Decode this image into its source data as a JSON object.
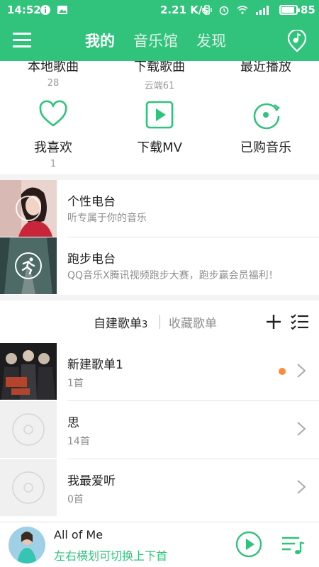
{
  "status_bar": {
    "time": "14:52",
    "network_speed": "2.21 K/s",
    "battery": "85"
  },
  "app_bar": {
    "tabs": [
      {
        "label": "我的",
        "active": true
      },
      {
        "label": "音乐馆",
        "active": false
      },
      {
        "label": "发现",
        "active": false
      }
    ]
  },
  "quick_access": {
    "row1": [
      {
        "label": "本地歌曲",
        "sub": "28"
      },
      {
        "label": "下载歌曲",
        "sub": "云端61"
      },
      {
        "label": "最近播放",
        "sub": ""
      }
    ],
    "row2": [
      {
        "label": "我喜欢",
        "sub": "1",
        "icon": "heart-icon"
      },
      {
        "label": "下载MV",
        "sub": "",
        "icon": "video-play-icon"
      },
      {
        "label": "已购音乐",
        "sub": "",
        "icon": "purchased-disc-icon"
      }
    ]
  },
  "radios": [
    {
      "title": "个性电台",
      "desc": "听专属于你的音乐"
    },
    {
      "title": "跑步电台",
      "desc": "QQ音乐X腾讯视频跑步大赛，跑步赢会员福利！"
    }
  ],
  "playlists": {
    "tab_created": "自建歌单",
    "tab_created_count": "3",
    "tab_collected": "收藏歌单",
    "items": [
      {
        "name": "新建歌单1",
        "count": "1首",
        "has_dot": true
      },
      {
        "name": "思",
        "count": "14首",
        "has_dot": false
      },
      {
        "name": "我最爱听",
        "count": "0首",
        "has_dot": false
      }
    ]
  },
  "mini_player": {
    "title": "All of Me",
    "subtitle": "左右横划可切换上下首"
  },
  "colors": {
    "brand_green": "#31c27c",
    "notify_orange": "#ff8a3c"
  }
}
